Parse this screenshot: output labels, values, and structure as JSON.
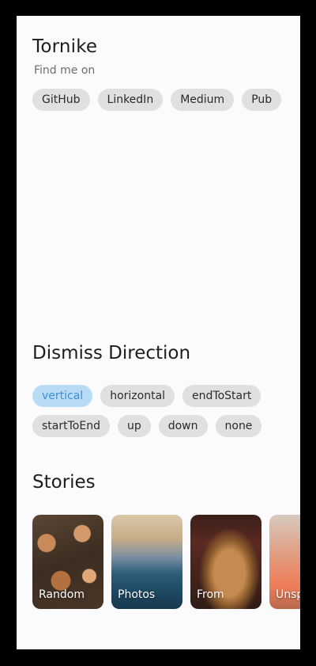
{
  "profile": {
    "name": "Tornike",
    "subtitle": "Find me on",
    "links": [
      "GitHub",
      "LinkedIn",
      "Medium",
      "Pub"
    ]
  },
  "dismiss": {
    "title": "Dismiss Direction",
    "options": [
      "vertical",
      "horizontal",
      "endToStart",
      "startToEnd",
      "up",
      "down",
      "none"
    ],
    "selected": "vertical"
  },
  "stories": {
    "title": "Stories",
    "items": [
      "Random",
      "Photos",
      "From",
      "Unsp"
    ]
  },
  "colors": {
    "selected_chip_bg": "#b9dcf6",
    "selected_chip_text": "#3f8ed0",
    "chip_bg": "#e0e0e2"
  }
}
